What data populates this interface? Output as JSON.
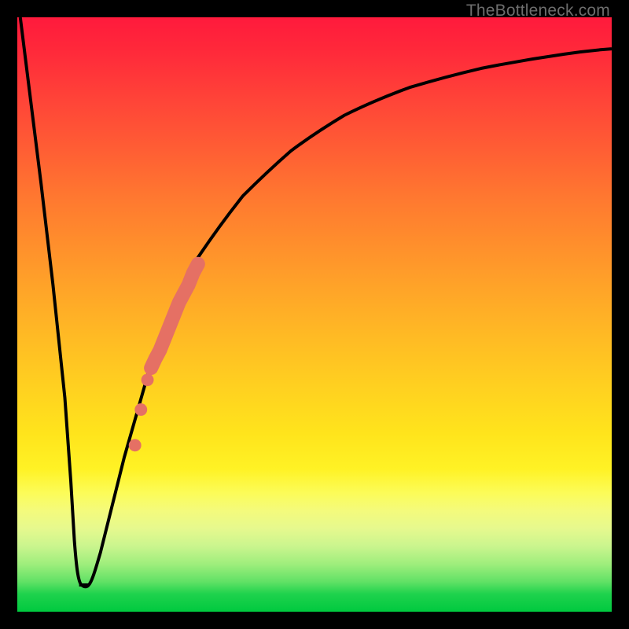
{
  "watermark": "TheBottleneck.com",
  "colors": {
    "frame": "#000000",
    "curve": "#000000",
    "marker_fill": "#e57064",
    "marker_stroke": "#e57064"
  },
  "chart_data": {
    "type": "line",
    "title": "",
    "xlabel": "",
    "ylabel": "",
    "xlim": [
      0,
      100
    ],
    "ylim": [
      0,
      100
    ],
    "grid": false,
    "legend": false,
    "series": [
      {
        "name": "left-branch",
        "x": [
          0.5,
          2,
          4,
          6,
          8,
          9,
          9.6,
          10.4,
          11.2,
          12.0
        ],
        "y": [
          100,
          88,
          72,
          55,
          36,
          22,
          12,
          6.0,
          4.5,
          4.5
        ]
      },
      {
        "name": "right-branch",
        "x": [
          12.0,
          13.0,
          14.0,
          16.0,
          18.0,
          20.0,
          22.0,
          24.0,
          27.0,
          30.0,
          34.0,
          38.0,
          42.0,
          46.0,
          50.0,
          55.0,
          60.0,
          66.0,
          72.0,
          78.0,
          85.0,
          92.0,
          100.0
        ],
        "y": [
          4.5,
          6.0,
          10.0,
          18.0,
          26.0,
          33.0,
          40.0,
          46.0,
          53.0,
          59.0,
          65.0,
          70.0,
          74.0,
          77.5,
          80.5,
          83.5,
          86.0,
          88.2,
          90.0,
          91.4,
          92.8,
          93.8,
          94.7
        ]
      }
    ],
    "bar_markers": {
      "x": [
        22.5,
        23.2,
        24.0,
        24.8,
        25.6,
        26.4,
        27.2,
        28.0,
        28.8,
        29.6,
        30.4
      ],
      "y": [
        41.0,
        42.5,
        44.0,
        46.0,
        48.0,
        50.0,
        52.0,
        53.5,
        55.0,
        57.0,
        58.5
      ]
    },
    "dot_markers": {
      "x": [
        21.9,
        20.8,
        19.8
      ],
      "y": [
        39.0,
        34.0,
        28.0
      ]
    }
  }
}
